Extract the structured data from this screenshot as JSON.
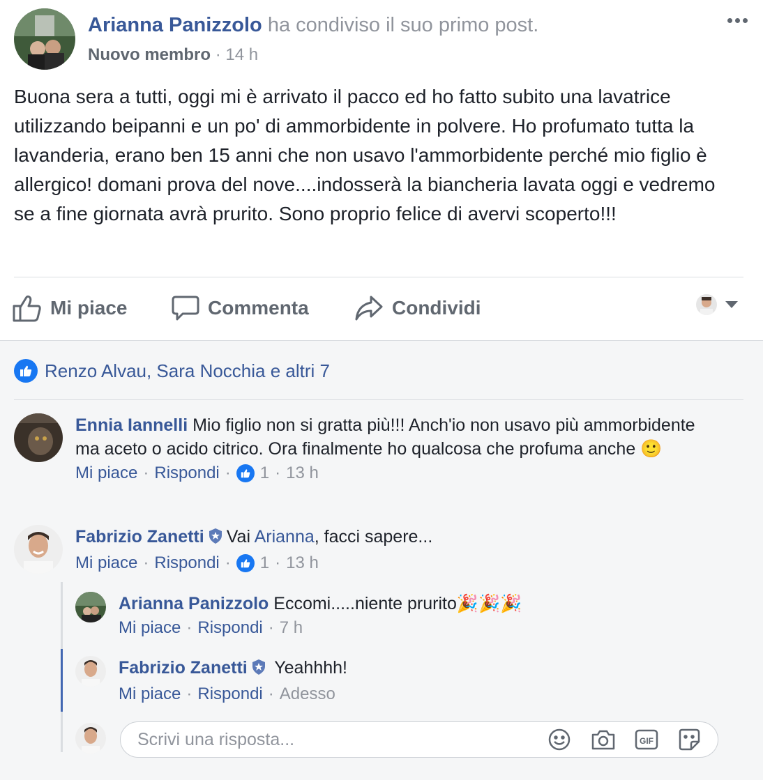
{
  "post": {
    "author": "Arianna Panizzolo",
    "action_text": "ha condiviso il suo primo post.",
    "role": "Nuovo membro",
    "separator": "·",
    "time": "14 h",
    "body": "Buona sera a tutti, oggi mi è arrivato il pacco ed ho fatto subito una lavatrice utilizzando beipanni e un po' di ammorbidente in polvere. Ho profumato tutta la lavanderia, erano ben 15 anni che non usavo l'ammorbidente perché mio figlio è allergico! domani prova del nove....indosserà la biancheria lavata oggi e vedremo se a fine giornata avrà prurito. Sono proprio felice di avervi scoperto!!!"
  },
  "actions": {
    "like": "Mi piace",
    "comment": "Commenta",
    "share": "Condividi"
  },
  "reactions": {
    "text": "Renzo Alvau, Sara Nocchia e altri 7"
  },
  "comments": [
    {
      "author": "Ennia Iannelli",
      "text": "Mio figlio non si gratta più!!! Anch'io non usavo più ammorbidente ma aceto o acido citrico. Ora finalmente ho qualcosa che profuma anche",
      "emoji": "🙂",
      "like_label": "Mi piace",
      "reply_label": "Rispondi",
      "sep": "·",
      "like_count": "1",
      "time": "13 h"
    },
    {
      "author": "Fabrizio Zanetti",
      "text_prefix": "Vai ",
      "mention": "Arianna",
      "text_suffix": ", facci sapere...",
      "like_label": "Mi piace",
      "reply_label": "Rispondi",
      "sep": "·",
      "like_count": "1",
      "time": "13 h"
    }
  ],
  "replies": [
    {
      "author": "Arianna Panizzolo",
      "text": "Eccomi.....niente prurito",
      "emoji": "🎉🎉🎉",
      "like_label": "Mi piace",
      "reply_label": "Rispondi",
      "sep": "·",
      "time": "7 h"
    },
    {
      "author": "Fabrizio Zanetti",
      "text": "Yeahhhh!",
      "like_label": "Mi piace",
      "reply_label": "Rispondi",
      "sep": "·",
      "time": "Adesso"
    }
  ],
  "reply_input": {
    "placeholder": "Scrivi una risposta...",
    "value": ""
  },
  "colors": {
    "link": "#385898",
    "like_blue": "#1877f2",
    "thread_active": "#4267b2",
    "muted": "#90949c"
  }
}
